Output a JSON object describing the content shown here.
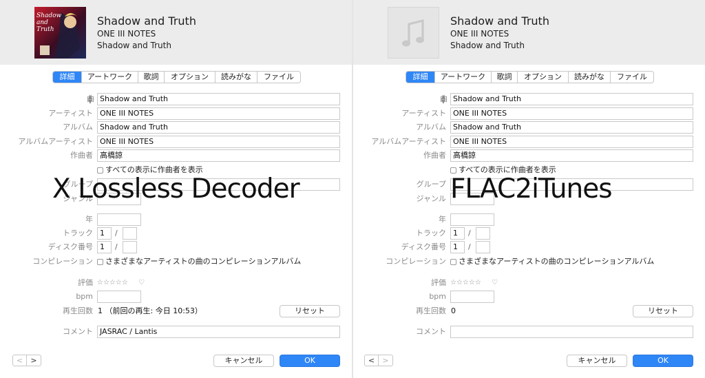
{
  "left": {
    "header": {
      "title": "Shadow and Truth",
      "artist": "ONE III NOTES",
      "album": "Shadow and Truth",
      "artwork_label": "Shadow and Truth"
    },
    "tabs": [
      "詳細",
      "アートワーク",
      "歌詞",
      "オプション",
      "読みがな",
      "ファイル"
    ],
    "active_tab_index": 0,
    "labels": {
      "song": "曲",
      "artist": "アーティスト",
      "album": "アルバム",
      "album_artist": "アルバムアーティスト",
      "composer": "作曲者",
      "group": "グループ",
      "genre": "ジャンル",
      "year": "年",
      "track": "トラック",
      "disc": "ディスク番号",
      "compilation": "コンピレーション",
      "rating": "評価",
      "bpm": "bpm",
      "play_count": "再生回数",
      "comment": "コメント"
    },
    "fields": {
      "song": "Shadow and Truth",
      "artist": "ONE III NOTES",
      "album": "Shadow and Truth",
      "album_artist": "ONE III NOTES",
      "composer": "高橋諒",
      "track_number": "1",
      "track_total": "",
      "disc_number": "1",
      "disc_total": "",
      "year": "",
      "group": "",
      "genre": "",
      "bpm": "",
      "comment": "JASRAC / Lantis"
    },
    "show_composer_label": "すべての表示に作曲者を表示",
    "compilation_label": "さまざまなアーティストの曲のコンピレーションアルバム",
    "rating_stars": "☆☆☆☆☆",
    "play_count_value": "1 （前回の再生: 今日 10:53）",
    "reset_label": "リセット",
    "cancel_label": "キャンセル",
    "ok_label": "OK",
    "nav_prev": "<",
    "nav_next": ">",
    "overlay_text": "X Lossless Decoder"
  },
  "right": {
    "header": {
      "title": "Shadow and Truth",
      "artist": "ONE III NOTES",
      "album": "Shadow and Truth"
    },
    "tabs": [
      "詳細",
      "アートワーク",
      "歌詞",
      "オプション",
      "読みがな",
      "ファイル"
    ],
    "active_tab_index": 0,
    "labels": {
      "song": "曲",
      "artist": "アーティスト",
      "album": "アルバム",
      "album_artist": "アルバムアーティスト",
      "composer": "作曲者",
      "group": "グループ",
      "genre": "ジャンル",
      "year": "年",
      "track": "トラック",
      "disc": "ディスク番号",
      "compilation": "コンピレーション",
      "rating": "評価",
      "bpm": "bpm",
      "play_count": "再生回数",
      "comment": "コメント"
    },
    "fields": {
      "song": "Shadow and Truth",
      "artist": "ONE III NOTES",
      "album": "Shadow and Truth",
      "album_artist": "ONE III NOTES",
      "composer": "高橋諒",
      "track_number": "1",
      "track_total": "",
      "disc_number": "1",
      "disc_total": "",
      "year": "",
      "group": "",
      "genre": "",
      "bpm": "",
      "comment": ""
    },
    "show_composer_label": "すべての表示に作曲者を表示",
    "compilation_label": "さまざまなアーティストの曲のコンピレーションアルバム",
    "rating_stars": "☆☆☆☆☆",
    "play_count_value": "0",
    "reset_label": "リセット",
    "cancel_label": "キャンセル",
    "ok_label": "OK",
    "nav_prev": "<",
    "nav_next": ">",
    "overlay_text": "FLAC2iTunes"
  },
  "colors": {
    "accent": "#2f86f6",
    "header_bg": "#ececec",
    "label_gray": "#8a8a8a"
  },
  "icons": {
    "sort": "sort-arrows-icon",
    "heart": "heart-icon",
    "music_note": "music-note-icon",
    "prev": "chevron-left-icon",
    "next": "chevron-right-icon"
  }
}
